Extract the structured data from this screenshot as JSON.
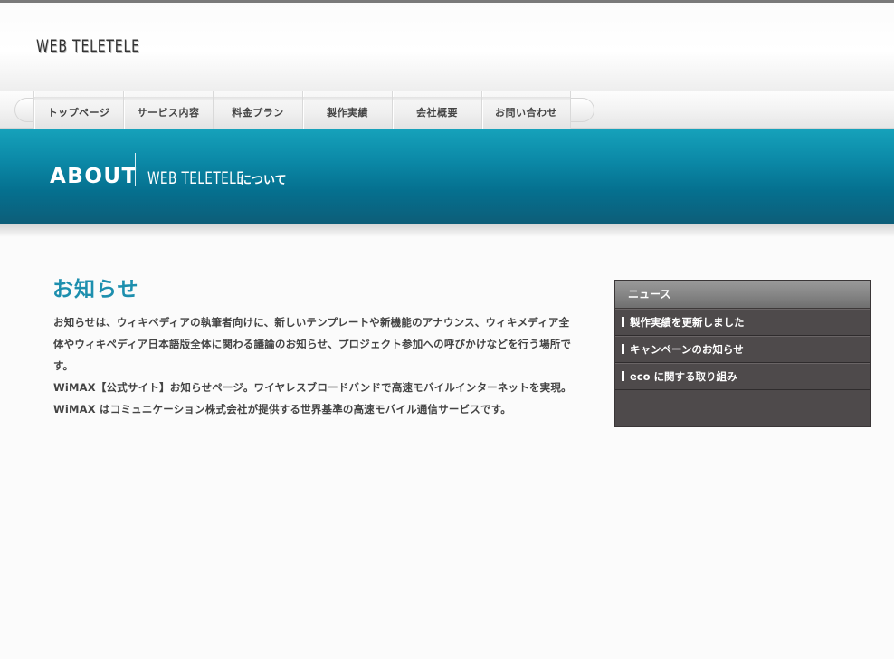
{
  "header": {
    "logo": "WEB TELETELE"
  },
  "nav": {
    "items": [
      {
        "label": "トップページ"
      },
      {
        "label": "サービス内容"
      },
      {
        "label": "料金プラン"
      },
      {
        "label": "製作実績"
      },
      {
        "label": "会社概要"
      },
      {
        "label": "お問い合わせ"
      }
    ]
  },
  "banner": {
    "title": "ABOUT",
    "subtitle_en": "WEB TELETELE",
    "subtitle_jp": "について"
  },
  "main": {
    "title": "お知らせ",
    "paragraphs": [
      "お知らせは、ウィキペディアの執筆者向けに、新しいテンプレートや新機能のアナウンス、ウィキメディア全体やウィキペディア日本語版全体に関わる議論のお知らせ、プロジェクト参加への呼びかけなどを行う場所です。",
      "WiMAX【公式サイト】お知らせページ。ワイヤレスブロードバンドで高速モバイルインターネットを実現。",
      "WiMAX はコミュニケーション株式会社が提供する世界基準の高速モバイル通信サービスです。"
    ]
  },
  "sidebar": {
    "title": "ニュース",
    "items": [
      {
        "label": "製作実績を更新しました"
      },
      {
        "label": "キャンペーンのお知らせ"
      },
      {
        "label": "eco に関する取り組み"
      }
    ]
  }
}
